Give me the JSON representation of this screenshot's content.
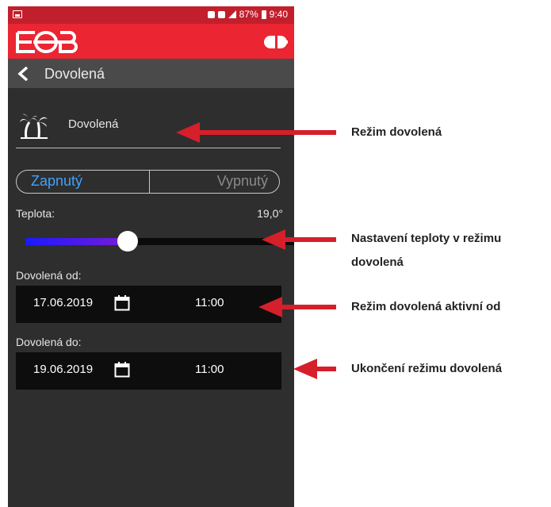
{
  "status_bar": {
    "battery": "87%",
    "time": "9:40"
  },
  "nav": {
    "title": "Dovolená"
  },
  "mode": {
    "label": "Dovolená",
    "icon": "palm-tree-icon"
  },
  "toggle": {
    "on_label": "Zapnutý",
    "off_label": "Vypnutý",
    "selected": "Zapnutý"
  },
  "temperature": {
    "label": "Teplota:",
    "value": "19,0°",
    "slider_fraction": 0.38
  },
  "vacation_from": {
    "label": "Dovolená od:",
    "date": "17.06.2019",
    "time": "11:00"
  },
  "vacation_to": {
    "label": "Dovolená do:",
    "date": "19.06.2019",
    "time": "11:00"
  },
  "annotations": {
    "mode": "Režim dovolená",
    "temperature_line1": "Nastavení teploty v režimu",
    "temperature_line2": "dovolená",
    "active_from": "Režim dovolená aktivní od",
    "end": "Ukončení režimu dovolená"
  },
  "colors": {
    "app_bar": "#eb2532",
    "status_bar": "#c21f2c",
    "background": "#2e2e2e",
    "toggle_active": "#3ea3ff",
    "arrow": "#d51f2a",
    "slider_start": "#1a1aff",
    "slider_end": "#7a1bd6"
  }
}
